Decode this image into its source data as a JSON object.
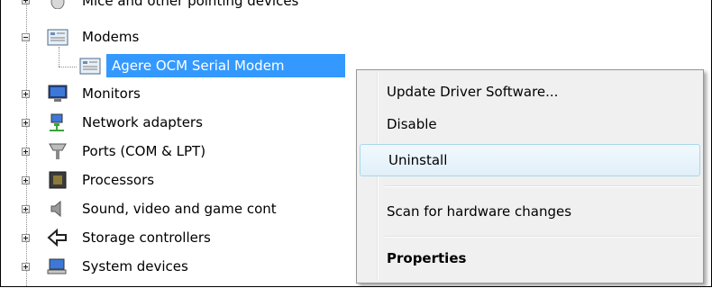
{
  "tree": {
    "partial_top": "Mice and other pointing devices",
    "items": [
      {
        "label": "Modems",
        "icon": "modem-icon",
        "expanded": true
      },
      {
        "label": "Monitors",
        "icon": "monitor-icon",
        "expanded": false
      },
      {
        "label": "Network adapters",
        "icon": "network-adapter-icon",
        "expanded": false
      },
      {
        "label": "Ports (COM & LPT)",
        "icon": "port-icon",
        "expanded": false
      },
      {
        "label": "Processors",
        "icon": "processor-icon",
        "expanded": false
      },
      {
        "label": "Sound, video and game cont",
        "icon": "speaker-icon",
        "expanded": false
      },
      {
        "label": "Storage controllers",
        "icon": "storage-icon",
        "expanded": false
      },
      {
        "label": "System devices",
        "icon": "computer-icon",
        "expanded": false
      }
    ],
    "selected_child": {
      "label": "Agere OCM Serial Modem",
      "icon": "modem-icon"
    }
  },
  "context_menu": {
    "items": [
      {
        "label": "Update Driver Software..."
      },
      {
        "label": "Disable"
      },
      {
        "label": "Uninstall",
        "state": "hover"
      },
      {
        "label": "Scan for hardware changes"
      },
      {
        "label": "Properties",
        "bold": true
      }
    ]
  },
  "colors": {
    "selection": "#3399ff",
    "menu_background": "#f0f0f0",
    "menu_hover_border": "#a8d8eb"
  }
}
